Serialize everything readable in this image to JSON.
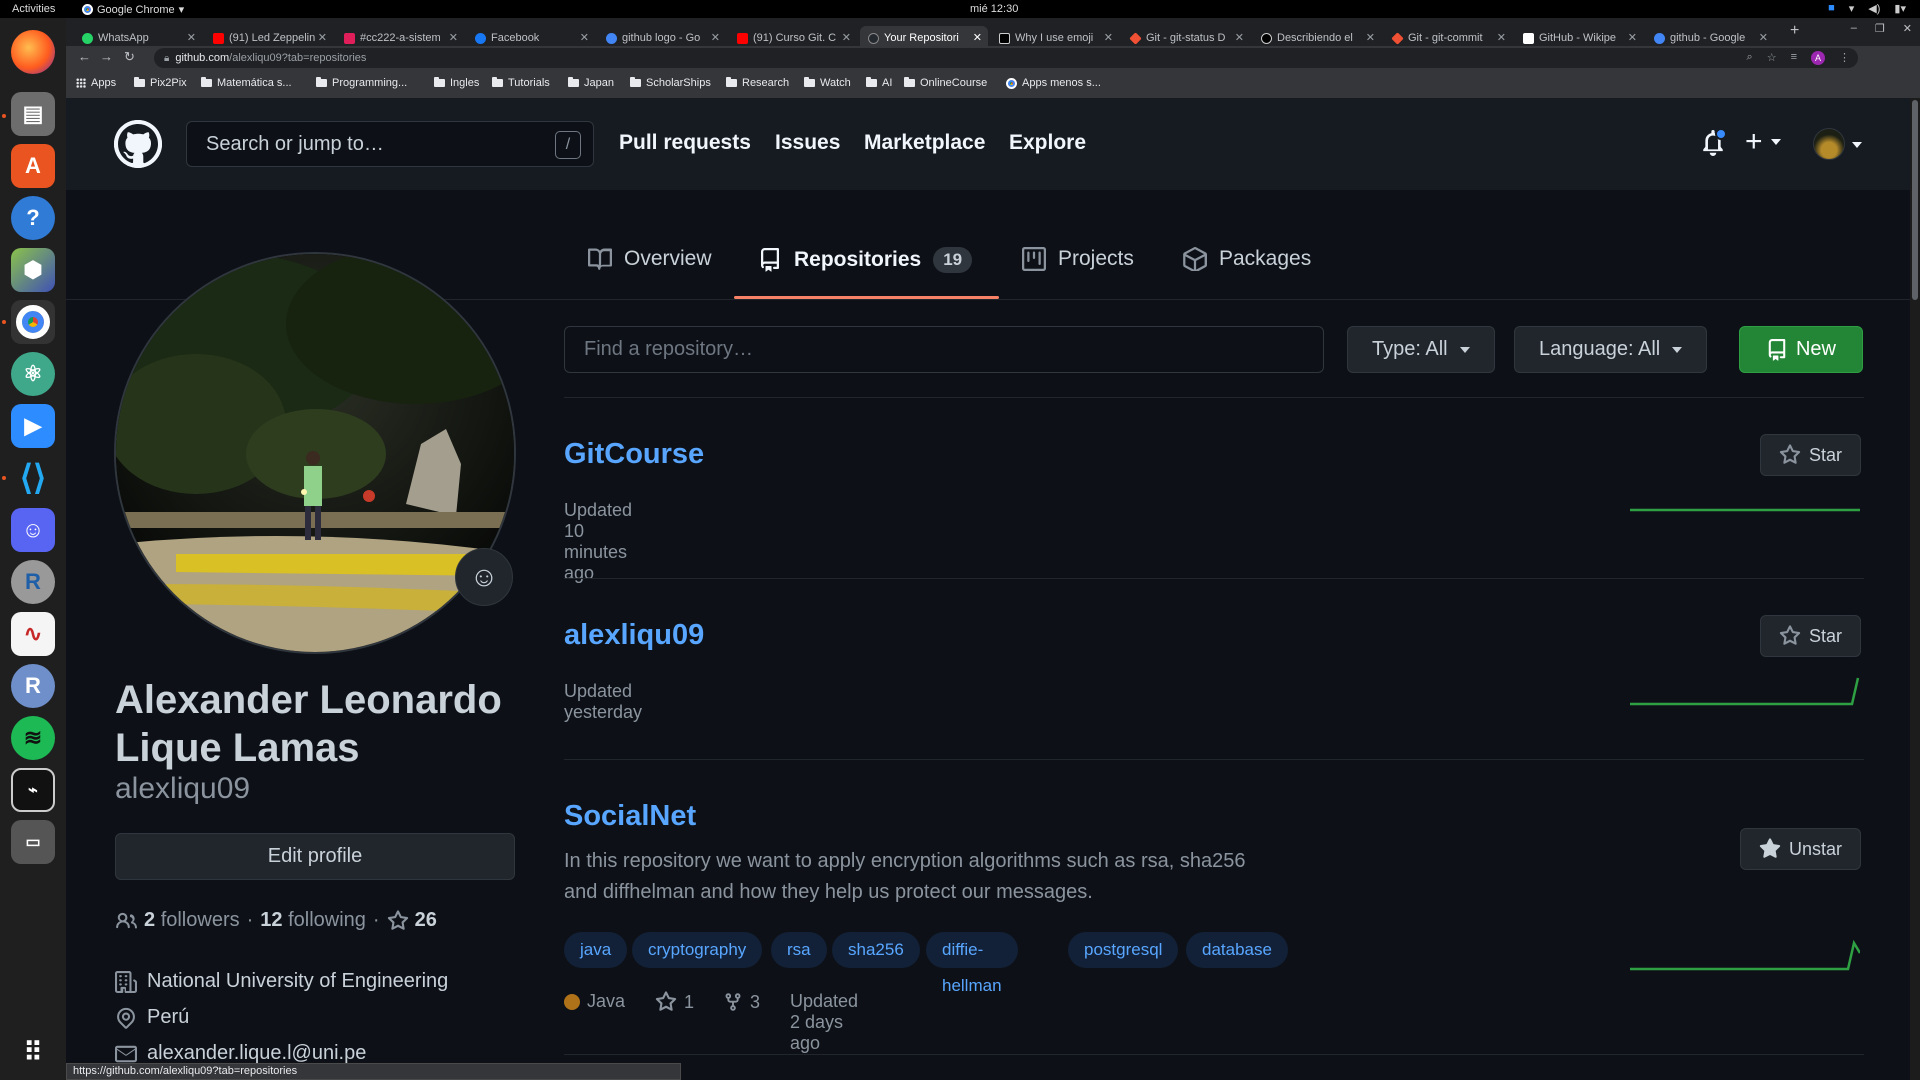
{
  "os": {
    "activities": "Activities",
    "app_name": "Google Chrome",
    "clock": "mié 12:30"
  },
  "browser": {
    "tabs": [
      {
        "label": "WhatsApp",
        "color": "#25d366"
      },
      {
        "label": "(91) Led Zeppelin",
        "color": "#ff0000"
      },
      {
        "label": "#cc222-a-sistem",
        "color": "#e01e5a"
      },
      {
        "label": "Facebook",
        "color": "#1877f2"
      },
      {
        "label": "github logo - Go",
        "color": "#4285f4"
      },
      {
        "label": "(91) Curso Git. C",
        "color": "#ff0000"
      },
      {
        "label": "Your Repositori",
        "color": "#24292f"
      },
      {
        "label": "Why I use emoji",
        "color": "#000000"
      },
      {
        "label": "Git - git-status D",
        "color": "#f05033"
      },
      {
        "label": "Describiendo el",
        "color": "#000000"
      },
      {
        "label": "Git - git-commit",
        "color": "#f05033"
      },
      {
        "label": "GitHub - Wikipe",
        "color": "#ffffff"
      },
      {
        "label": "github - Google",
        "color": "#4285f4"
      }
    ],
    "url_host": "github.com",
    "url_path": "/alexliqu09?tab=repositories",
    "profile_initial": "A",
    "bookmarks": [
      "Apps",
      "Pix2Pix",
      "Matemática s...",
      "Programming...",
      "Ingles",
      "Tutorials",
      "Japan",
      "ScholarShips",
      "Research",
      "Watch",
      "AI",
      "OnlineCourse",
      "Apps menos s..."
    ],
    "status_url": "https://github.com/alexliqu09?tab=repositories"
  },
  "github": {
    "search_placeholder": "Search or jump to…",
    "search_key": "/",
    "nav": [
      "Pull requests",
      "Issues",
      "Marketplace",
      "Explore"
    ],
    "tabs": {
      "overview": "Overview",
      "repositories": "Repositories",
      "repositories_count": "19",
      "projects": "Projects",
      "packages": "Packages"
    }
  },
  "profile": {
    "full_name": "Alexander Leonardo Lique Lamas",
    "username": "alexliqu09",
    "edit_label": "Edit profile",
    "followers_count": "2",
    "followers_label": "followers",
    "following_count": "12",
    "following_label": "following",
    "stars_count": "26",
    "organization": "National University of Engineering",
    "location": "Perú",
    "email": "alexander.lique.l@uni.pe"
  },
  "repo_filter": {
    "find_placeholder": "Find a repository…",
    "type_label": "Type:",
    "type_value": "All",
    "language_label": "Language:",
    "language_value": "All",
    "new_label": "New"
  },
  "repos": [
    {
      "name": "GitCourse",
      "updated": "Updated 10 minutes ago",
      "star_label": "Star"
    },
    {
      "name": "alexliqu09",
      "updated": "Updated yesterday",
      "star_label": "Star"
    },
    {
      "name": "SocialNet",
      "description": "In this repository we want to apply encryption algorithms such as rsa, sha256 and diffhelman and how they help us protect our messages.",
      "topics": [
        "java",
        "cryptography",
        "rsa",
        "sha256",
        "diffie-hellman",
        "postgresql",
        "database"
      ],
      "language": "Java",
      "language_color": "#b07219",
      "stars": "1",
      "forks": "3",
      "updated": "Updated 2 days ago",
      "star_label": "Unstar"
    }
  ],
  "colors": {
    "background": "#0d1117",
    "header": "#161b22",
    "link": "#58a6ff",
    "primary_button": "#238636",
    "tab_underline": "#f78166"
  }
}
